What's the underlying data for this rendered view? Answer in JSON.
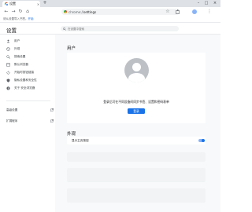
{
  "browser": {
    "tab_title": "设置",
    "tab_close": "×",
    "new_tab": "+",
    "window_controls": {
      "minimize": "–",
      "maximize": "□",
      "close": "×"
    }
  },
  "toolbar": {
    "back": "←",
    "forward": "→",
    "reload": "↻",
    "home": "⌂",
    "url_scheme": "chrome://",
    "url_path": "settings",
    "bookmark_star": "☆",
    "menu": "⋮"
  },
  "bookmarks_bar": {
    "prefix": "请从设置导入书签。",
    "link": "开始"
  },
  "settings": {
    "title": "设置",
    "search_placeholder": "在设置中搜索"
  },
  "sidebar": {
    "items": [
      {
        "label": "用户",
        "icon": "person-icon"
      },
      {
        "label": "外观",
        "icon": "palette-icon"
      },
      {
        "label": "搜索设置",
        "icon": "search-icon"
      },
      {
        "label": "默认浏览器",
        "icon": "browser-icon"
      },
      {
        "label": "开始时按钮链接",
        "icon": "power-icon"
      },
      {
        "label": "隐私设置和安全性",
        "icon": "shield-icon"
      },
      {
        "label": "关于 安全浏览器",
        "icon": "info-icon"
      }
    ],
    "footer_items": [
      {
        "label": "高级设置",
        "icon": "external-link-icon"
      },
      {
        "label": "扩展程序",
        "icon": "external-link-icon"
      }
    ]
  },
  "main": {
    "people_section": "用户",
    "signin_text": "登录后可在不同设备间同步书签、设置和密码表单",
    "signin_button": "登录",
    "appearance_section": "外观",
    "appearance_row_label": "显示主页按钮"
  },
  "colors": {
    "accent": "#1a73e8",
    "page_bg": "#f8f9fa",
    "tab_strip": "#dee1e6"
  }
}
